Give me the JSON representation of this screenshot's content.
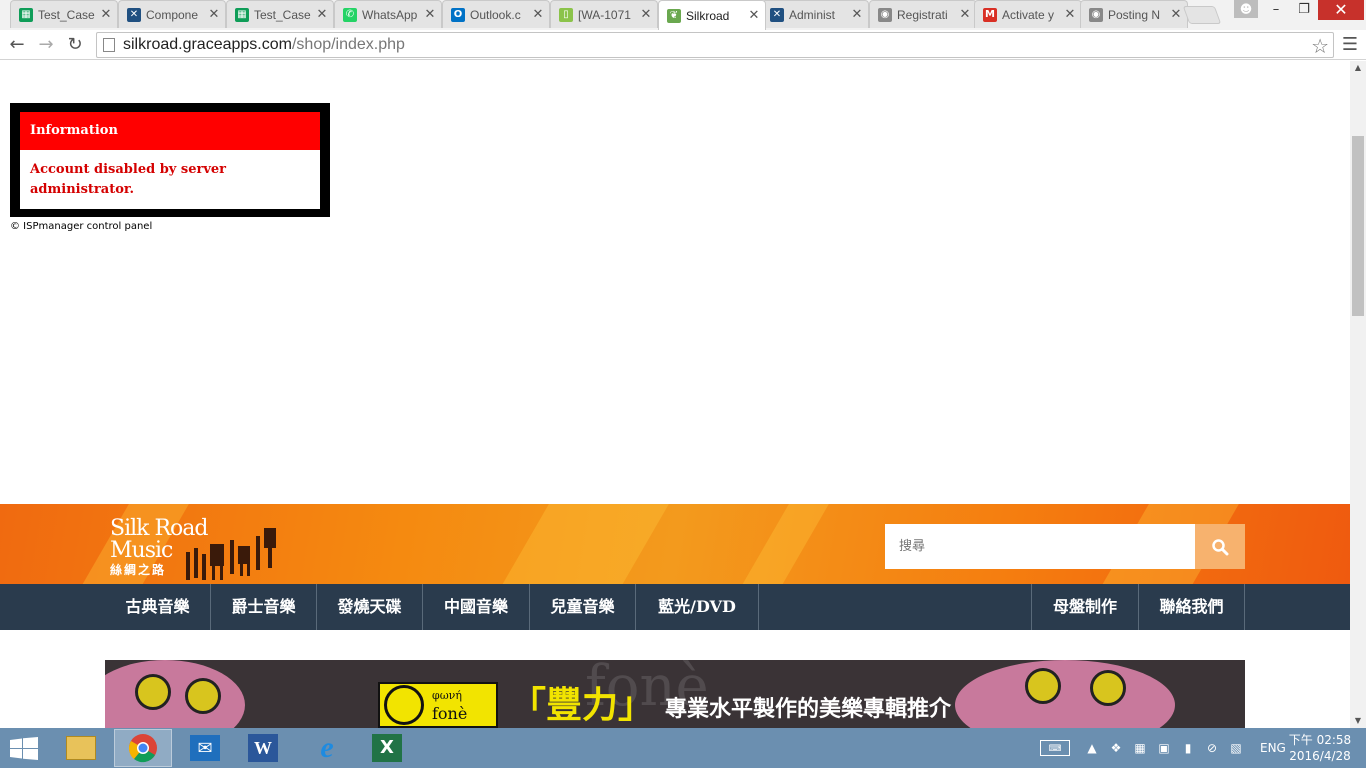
{
  "browser": {
    "tabs": [
      {
        "label": "Test_Case",
        "icon": "sheets-icon",
        "color": "#0f9d58"
      },
      {
        "label": "Compone",
        "icon": "jira-icon",
        "color": "#205081"
      },
      {
        "label": "Test_Case",
        "icon": "sheets-icon",
        "color": "#0f9d58"
      },
      {
        "label": "WhatsApp",
        "icon": "whatsapp-icon",
        "color": "#25d366"
      },
      {
        "label": "Outlook.c",
        "icon": "outlook-icon",
        "color": "#0072c6"
      },
      {
        "label": "[WA-1071",
        "icon": "page-icon",
        "color": "#8bc34a"
      },
      {
        "label": "Silkroad",
        "icon": "leaf-icon",
        "color": "#6aa84f"
      },
      {
        "label": "Administ",
        "icon": "jira-icon",
        "color": "#205081"
      },
      {
        "label": "Registrati",
        "icon": "globe-icon",
        "color": "#888888"
      },
      {
        "label": "Activate y",
        "icon": "gmail-icon",
        "color": "#d93025"
      },
      {
        "label": "Posting N",
        "icon": "globe-icon",
        "color": "#888888"
      }
    ],
    "active_tab_index": 6,
    "url_host": "silkroad.graceapps.com",
    "url_path": "/shop/index.php"
  },
  "error_box": {
    "title": "Information",
    "message": "Account disabled by server administrator.",
    "copyright": "© ISPmanager control panel"
  },
  "site": {
    "logo_line1": "Silk Road",
    "logo_line2": "Music",
    "logo_line3": "絲綢之路",
    "search_placeholder": "搜尋",
    "nav_left": [
      "古典音樂",
      "爵士音樂",
      "發燒天碟",
      "中國音樂",
      "兒童音樂",
      "藍光/DVD"
    ],
    "nav_right": [
      "母盤制作",
      "聯絡我們"
    ],
    "promo": {
      "brand_small": "φωνή",
      "brand_name": "fonè",
      "headline": "「豐力」",
      "tagline": "專業水平製作的美樂專輯推介",
      "bg_word": "fonè"
    },
    "colors": {
      "banner": "#f57d0f",
      "nav": "#2a3b4d",
      "search_button": "#f7b26e"
    }
  },
  "taskbar": {
    "apps": [
      "file-explorer-icon",
      "chrome-icon",
      "mail-icon",
      "word-icon",
      "ie-icon",
      "excel-icon"
    ],
    "active_app_index": 1,
    "lang": "ENG",
    "time": "下午 02:58",
    "date": "2016/4/28"
  }
}
